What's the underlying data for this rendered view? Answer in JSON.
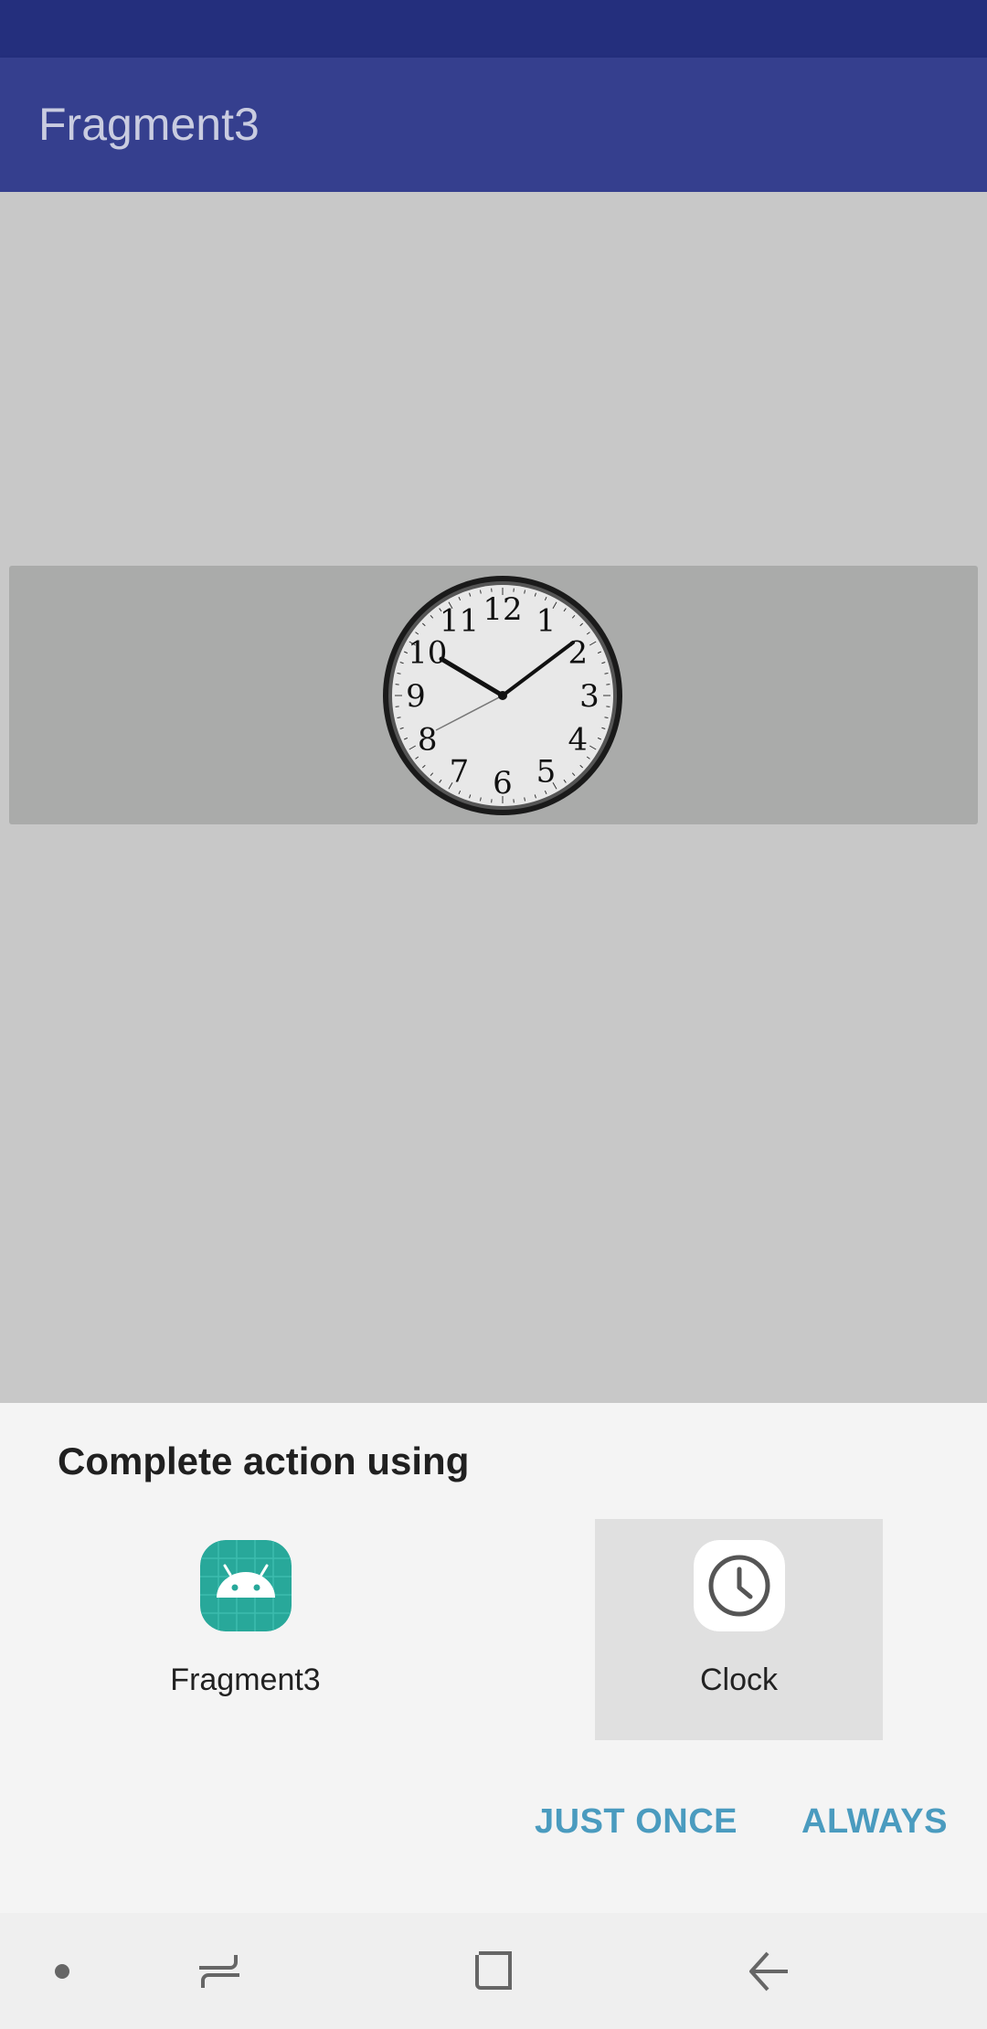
{
  "app_bar": {
    "title": "Fragment3"
  },
  "chooser": {
    "title": "Complete action using",
    "options": [
      {
        "label": "Fragment3",
        "icon": "android-app-icon",
        "selected": false
      },
      {
        "label": "Clock",
        "icon": "clock-app-icon",
        "selected": true
      }
    ],
    "buttons": {
      "just_once": "JUST ONCE",
      "always": "ALWAYS"
    }
  },
  "clock_numbers": [
    "12",
    "1",
    "2",
    "3",
    "4",
    "5",
    "6",
    "7",
    "8",
    "9",
    "10",
    "11"
  ],
  "nav_bar": {
    "items": [
      "dot-icon",
      "recents-icon",
      "home-icon",
      "back-icon"
    ]
  },
  "colors": {
    "status_bar": "#242f7d",
    "app_bar": "#353f8e",
    "accent": "#4a9bbf",
    "android_icon": "#28a89a"
  }
}
